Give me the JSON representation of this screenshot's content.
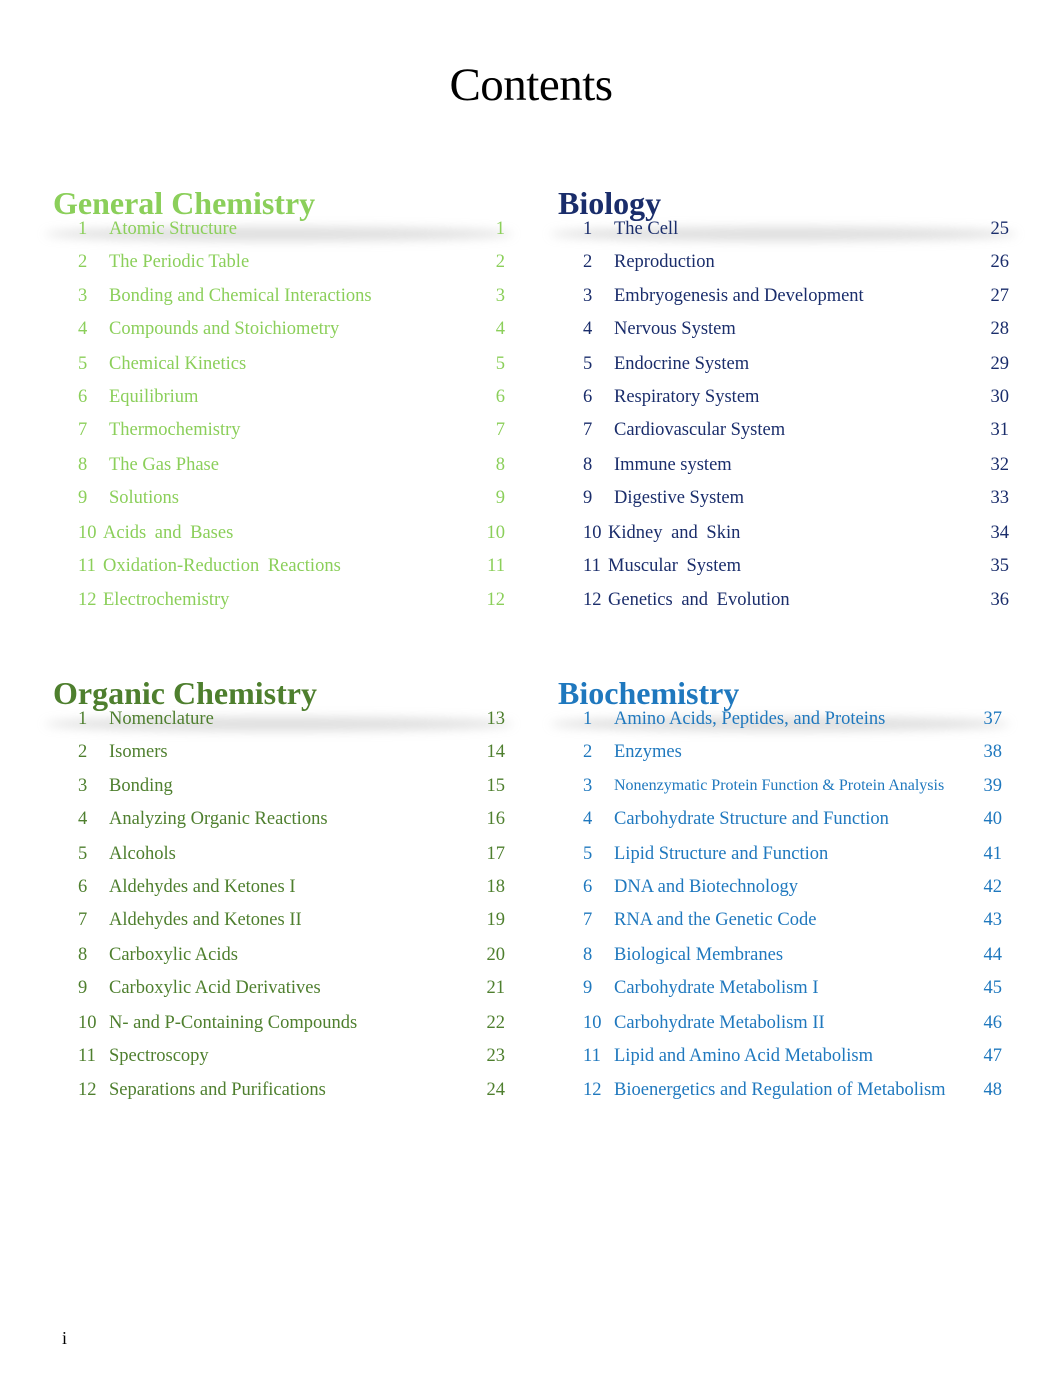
{
  "title": "Contents",
  "colors": {
    "general_chemistry": "#8BCF5A",
    "organic_chemistry": "#4E7F2E",
    "biology": "#1A2D6B",
    "biochemistry": "#1F78BE"
  },
  "sections": [
    {
      "heading": "General Chemistry",
      "items": [
        {
          "num": "1",
          "label": "Atomic Structure",
          "page": "1"
        },
        {
          "num": "2",
          "label": "The Periodic Table",
          "page": "2"
        },
        {
          "num": "3",
          "label": "Bonding and Chemical Interactions",
          "page": "3"
        },
        {
          "num": "4",
          "label": "Compounds and Stoichiometry",
          "page": "4"
        },
        {
          "num": "5",
          "label": "Chemical Kinetics",
          "page": "5"
        },
        {
          "num": "6",
          "label": "Equilibrium",
          "page": "6"
        },
        {
          "num": "7",
          "label": "Thermochemistry",
          "page": "7"
        },
        {
          "num": "8",
          "label": "The Gas Phase",
          "page": "8"
        },
        {
          "num": "9",
          "label": "Solutions",
          "page": "9"
        },
        {
          "num": "10",
          "label": "Acids and Bases",
          "page": "10"
        },
        {
          "num": "11",
          "label": "Oxidation-Reduction Reactions",
          "page": "11"
        },
        {
          "num": "12",
          "label": "Electrochemistry",
          "page": "12"
        }
      ]
    },
    {
      "heading": "Biology",
      "items": [
        {
          "num": "1",
          "label": "The Cell",
          "page": "25"
        },
        {
          "num": "2",
          "label": "Reproduction",
          "page": "26"
        },
        {
          "num": "3",
          "label": "Embryogenesis and Development",
          "page": "27"
        },
        {
          "num": "4",
          "label": "Nervous System",
          "page": "28"
        },
        {
          "num": "5",
          "label": "Endocrine System",
          "page": "29"
        },
        {
          "num": "6",
          "label": "Respiratory System",
          "page": "30"
        },
        {
          "num": "7",
          "label": "Cardiovascular System",
          "page": "31"
        },
        {
          "num": "8",
          "label": "Immune system",
          "page": "32"
        },
        {
          "num": "9",
          "label": "Digestive System",
          "page": "33"
        },
        {
          "num": "10",
          "label": "Kidney and Skin",
          "page": "34"
        },
        {
          "num": "11",
          "label": "Muscular System",
          "page": "35"
        },
        {
          "num": "12",
          "label": "Genetics and Evolution",
          "page": "36"
        }
      ]
    },
    {
      "heading": "Organic Chemistry",
      "items": [
        {
          "num": "1",
          "label": "Nomenclature",
          "page": "13"
        },
        {
          "num": "2",
          "label": "Isomers",
          "page": "14"
        },
        {
          "num": "3",
          "label": "Bonding",
          "page": "15"
        },
        {
          "num": "4",
          "label": "Analyzing Organic Reactions",
          "page": "16"
        },
        {
          "num": "5",
          "label": "Alcohols",
          "page": "17"
        },
        {
          "num": "6",
          "label": "Aldehydes and Ketones I",
          "page": "18"
        },
        {
          "num": "7",
          "label": "Aldehydes and Ketones II",
          "page": "19"
        },
        {
          "num": "8",
          "label": "Carboxylic Acids",
          "page": "20"
        },
        {
          "num": "9",
          "label": "Carboxylic Acid Derivatives",
          "page": "21"
        },
        {
          "num": "10",
          "label": "N- and P-Containing Compounds",
          "page": "22"
        },
        {
          "num": "11",
          "label": "Spectroscopy",
          "page": "23"
        },
        {
          "num": "12",
          "label": "Separations and Purifications",
          "page": "24"
        }
      ]
    },
    {
      "heading": "Biochemistry",
      "items": [
        {
          "num": "1",
          "label": "Amino Acids, Peptides, and Proteins",
          "page": "37"
        },
        {
          "num": "2",
          "label": "Enzymes",
          "page": "38"
        },
        {
          "num": "3",
          "label": "Nonenzymatic Protein Function & Protein Analysis",
          "page": "39"
        },
        {
          "num": "4",
          "label": "Carbohydrate Structure and Function",
          "page": "40"
        },
        {
          "num": "5",
          "label": "Lipid Structure and Function",
          "page": "41"
        },
        {
          "num": "6",
          "label": "DNA and Biotechnology",
          "page": "42"
        },
        {
          "num": "7",
          "label": "RNA and the Genetic Code",
          "page": "43"
        },
        {
          "num": "8",
          "label": "Biological Membranes",
          "page": "44"
        },
        {
          "num": "9",
          "label": "Carbohydrate Metabolism I",
          "page": "45"
        },
        {
          "num": "10",
          "label": "Carbohydrate Metabolism II",
          "page": "46"
        },
        {
          "num": "11",
          "label": "Lipid and Amino Acid Metabolism",
          "page": "47"
        },
        {
          "num": "12",
          "label": "Bioenergetics and Regulation of Metabolism",
          "page": "48"
        }
      ]
    }
  ],
  "footer": {
    "page_number": "i"
  }
}
